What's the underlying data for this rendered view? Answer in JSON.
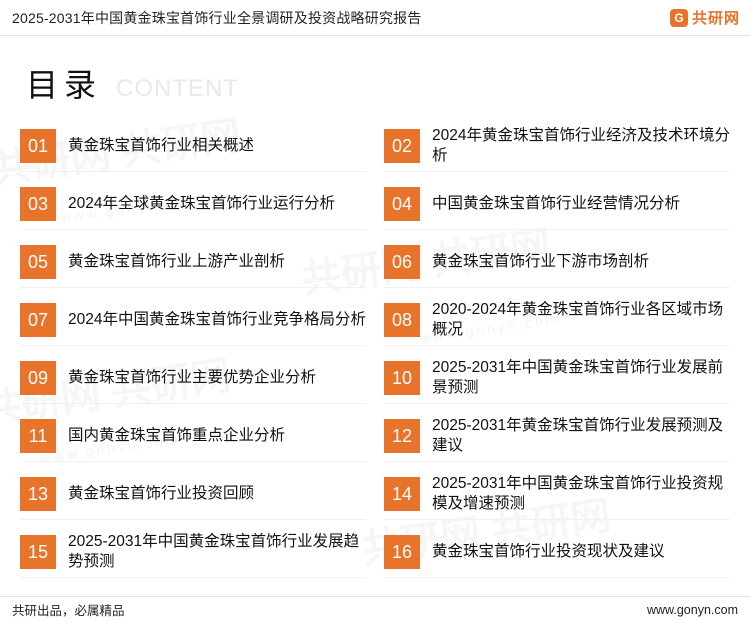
{
  "header": {
    "title": "2025-2031年中国黄金珠宝首饰行业全景调研及投资战略研究报告",
    "brand_mark": "G",
    "brand_name": "共研网"
  },
  "heading": {
    "cn": "目录",
    "en": "CONTENT"
  },
  "watermarks": {
    "big": "共研网 共研网",
    "small": "www.gonyn.com"
  },
  "toc": [
    {
      "num": "01",
      "label": "黄金珠宝首饰行业相关概述"
    },
    {
      "num": "02",
      "label": "2024年黄金珠宝首饰行业经济及技术环境分析"
    },
    {
      "num": "03",
      "label": "2024年全球黄金珠宝首饰行业运行分析"
    },
    {
      "num": "04",
      "label": "中国黄金珠宝首饰行业经营情况分析"
    },
    {
      "num": "05",
      "label": "黄金珠宝首饰行业上游产业剖析"
    },
    {
      "num": "06",
      "label": "黄金珠宝首饰行业下游市场剖析"
    },
    {
      "num": "07",
      "label": "2024年中国黄金珠宝首饰行业竞争格局分析"
    },
    {
      "num": "08",
      "label": "2020-2024年黄金珠宝首饰行业各区域市场概况"
    },
    {
      "num": "09",
      "label": "黄金珠宝首饰行业主要优势企业分析"
    },
    {
      "num": "10",
      "label": "2025-2031年中国黄金珠宝首饰行业发展前景预测"
    },
    {
      "num": "11",
      "label": "国内黄金珠宝首饰重点企业分析"
    },
    {
      "num": "12",
      "label": "2025-2031年黄金珠宝首饰行业发展预测及建议"
    },
    {
      "num": "13",
      "label": "黄金珠宝首饰行业投资回顾"
    },
    {
      "num": "14",
      "label": "2025-2031年中国黄金珠宝首饰行业投资规模及增速预测"
    },
    {
      "num": "15",
      "label": "2025-2031年中国黄金珠宝首饰行业发展趋势预测"
    },
    {
      "num": "16",
      "label": "黄金珠宝首饰行业投资现状及建议"
    }
  ],
  "footer": {
    "slogan": "共研出品，必属精品",
    "url": "www.gonyn.com"
  },
  "colors": {
    "accent": "#e8732a"
  }
}
